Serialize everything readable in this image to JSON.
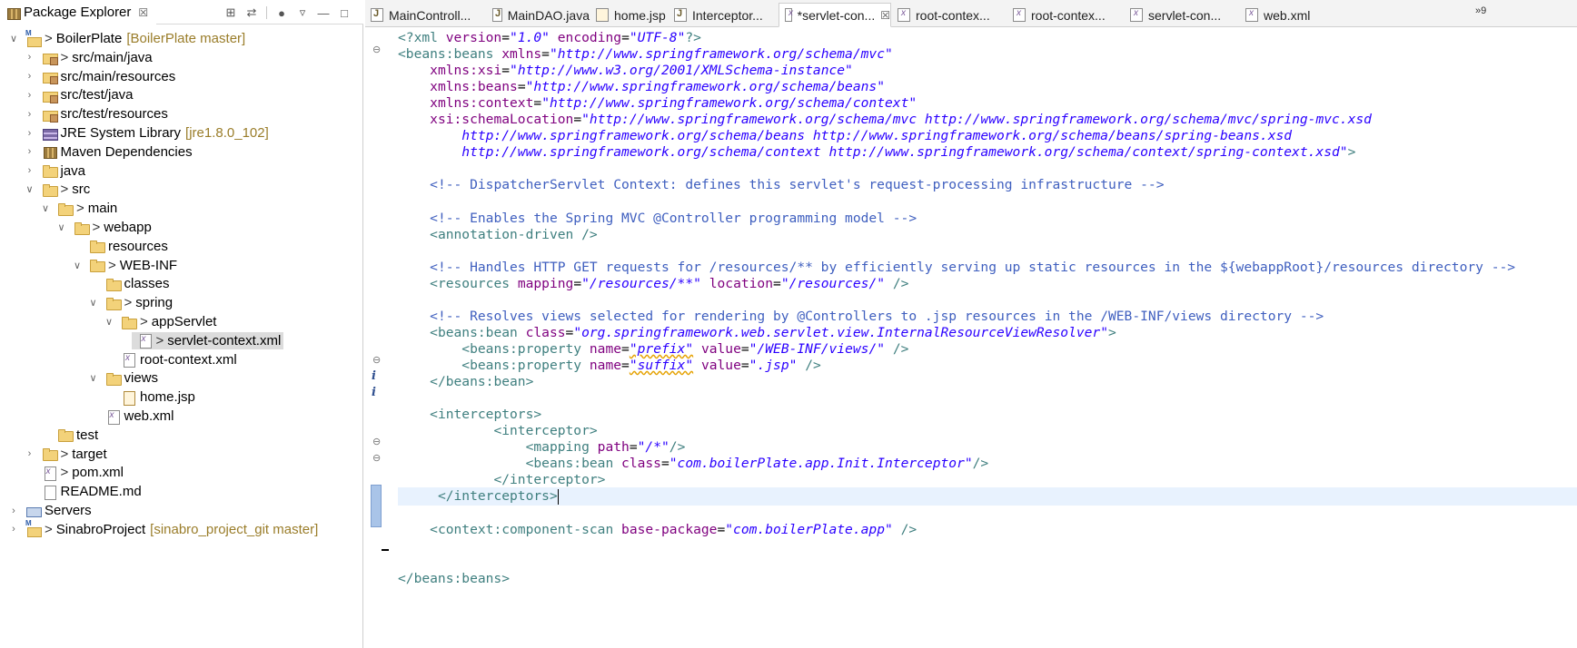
{
  "explorer": {
    "title": "Package Explorer",
    "close_glyph": "☒",
    "tree": [
      {
        "label": "BoilerPlate",
        "deco": ">",
        "git": "[BoilerPlate master]",
        "icon": "project",
        "level": 0,
        "twisty": "expanded"
      },
      {
        "label": "src/main/java",
        "deco": ">",
        "git": "",
        "icon": "pkgfolder",
        "level": 1,
        "twisty": "collapsed"
      },
      {
        "label": "src/main/resources",
        "deco": "",
        "git": "",
        "icon": "pkgfolder",
        "level": 1,
        "twisty": "collapsed"
      },
      {
        "label": "src/test/java",
        "deco": "",
        "git": "",
        "icon": "pkgfolder",
        "level": 1,
        "twisty": "collapsed"
      },
      {
        "label": "src/test/resources",
        "deco": "",
        "git": "",
        "icon": "pkgfolder",
        "level": 1,
        "twisty": "collapsed"
      },
      {
        "label": "JRE System Library",
        "deco": "",
        "git": "[jre1.8.0_102]",
        "icon": "jre",
        "level": 1,
        "twisty": "collapsed"
      },
      {
        "label": "Maven Dependencies",
        "deco": "",
        "git": "",
        "icon": "jar",
        "level": 1,
        "twisty": "collapsed"
      },
      {
        "label": "java",
        "deco": "",
        "git": "",
        "icon": "folder",
        "level": 1,
        "twisty": "collapsed"
      },
      {
        "label": "src",
        "deco": ">",
        "git": "",
        "icon": "folder",
        "level": 1,
        "twisty": "expanded"
      },
      {
        "label": "main",
        "deco": ">",
        "git": "",
        "icon": "folder",
        "level": 2,
        "twisty": "expanded"
      },
      {
        "label": "webapp",
        "deco": ">",
        "git": "",
        "icon": "folder",
        "level": 3,
        "twisty": "expanded"
      },
      {
        "label": "resources",
        "deco": "",
        "git": "",
        "icon": "folder",
        "level": 4,
        "twisty": "none"
      },
      {
        "label": "WEB-INF",
        "deco": ">",
        "git": "",
        "icon": "folder",
        "level": 4,
        "twisty": "expanded"
      },
      {
        "label": "classes",
        "deco": "",
        "git": "",
        "icon": "folder",
        "level": 5,
        "twisty": "none"
      },
      {
        "label": "spring",
        "deco": ">",
        "git": "",
        "icon": "folder",
        "level": 5,
        "twisty": "expanded"
      },
      {
        "label": "appServlet",
        "deco": ">",
        "git": "",
        "icon": "folder",
        "level": 6,
        "twisty": "expanded"
      },
      {
        "label": "servlet-context.xml",
        "deco": ">",
        "git": "",
        "icon": "xml",
        "level": 7,
        "twisty": "none",
        "selected": true
      },
      {
        "label": "root-context.xml",
        "deco": "",
        "git": "",
        "icon": "xml",
        "level": 6,
        "twisty": "none"
      },
      {
        "label": "views",
        "deco": "",
        "git": "",
        "icon": "folder",
        "level": 5,
        "twisty": "expanded"
      },
      {
        "label": "home.jsp",
        "deco": "",
        "git": "",
        "icon": "jsp",
        "level": 6,
        "twisty": "none"
      },
      {
        "label": "web.xml",
        "deco": "",
        "git": "",
        "icon": "xml",
        "level": 5,
        "twisty": "none"
      },
      {
        "label": "test",
        "deco": "",
        "git": "",
        "icon": "folder",
        "level": 2,
        "twisty": "none"
      },
      {
        "label": "target",
        "deco": ">",
        "git": "",
        "icon": "folder",
        "level": 1,
        "twisty": "collapsed"
      },
      {
        "label": "pom.xml",
        "deco": ">",
        "git": "",
        "icon": "xml",
        "level": 1,
        "twisty": "none"
      },
      {
        "label": "README.md",
        "deco": "",
        "git": "",
        "icon": "file",
        "level": 1,
        "twisty": "none"
      },
      {
        "label": "Servers",
        "deco": "",
        "git": "",
        "icon": "servers",
        "level": 0,
        "twisty": "collapsed"
      },
      {
        "label": "SinabroProject",
        "deco": ">",
        "git": "[sinabro_project_git master]",
        "icon": "project",
        "level": 0,
        "twisty": "collapsed"
      }
    ]
  },
  "editor": {
    "tabs": [
      {
        "label": "MainControll...",
        "icon": "java",
        "active": false
      },
      {
        "label": "MainDAO.java",
        "icon": "java",
        "active": false
      },
      {
        "label": "home.jsp",
        "icon": "jsp",
        "active": false
      },
      {
        "label": "Interceptor...",
        "icon": "java",
        "active": false
      },
      {
        "label": "*servlet-con...",
        "icon": "xml",
        "active": true
      },
      {
        "label": "root-contex...",
        "icon": "xml",
        "active": false
      },
      {
        "label": "root-contex...",
        "icon": "xml",
        "active": false
      },
      {
        "label": "servlet-con...",
        "icon": "xml",
        "active": false
      },
      {
        "label": "web.xml",
        "icon": "xml",
        "active": false
      }
    ],
    "overflow_count": "»9",
    "lines": [
      [
        [
          "pi",
          "<?xml "
        ],
        [
          "at",
          "version"
        ],
        [
          "",
          "="
        ],
        [
          "av",
          "\"1.0\""
        ],
        [
          "",
          " "
        ],
        [
          "at",
          "encoding"
        ],
        [
          "",
          "="
        ],
        [
          "av",
          "\"UTF-8\""
        ],
        [
          "pi",
          "?>"
        ]
      ],
      [
        [
          "tg",
          "<beans:beans "
        ],
        [
          "at",
          "xmlns"
        ],
        [
          "",
          "="
        ],
        [
          "av",
          "\"http://www.springframework.org/schema/mvc\""
        ]
      ],
      [
        [
          "",
          "    "
        ],
        [
          "at",
          "xmlns:xsi"
        ],
        [
          "",
          "="
        ],
        [
          "av",
          "\"http://www.w3.org/2001/XMLSchema-instance\""
        ]
      ],
      [
        [
          "",
          "    "
        ],
        [
          "at",
          "xmlns:beans"
        ],
        [
          "",
          "="
        ],
        [
          "av",
          "\"http://www.springframework.org/schema/beans\""
        ]
      ],
      [
        [
          "",
          "    "
        ],
        [
          "at",
          "xmlns:context"
        ],
        [
          "",
          "="
        ],
        [
          "av",
          "\"http://www.springframework.org/schema/context\""
        ]
      ],
      [
        [
          "",
          "    "
        ],
        [
          "at",
          "xsi:schemaLocation"
        ],
        [
          "",
          "="
        ],
        [
          "av",
          "\"http://www.springframework.org/schema/mvc http://www.springframework.org/schema/mvc/spring-mvc.xsd"
        ]
      ],
      [
        [
          "av",
          "        http://www.springframework.org/schema/beans http://www.springframework.org/schema/beans/spring-beans.xsd"
        ]
      ],
      [
        [
          "av",
          "        http://www.springframework.org/schema/context http://www.springframework.org/schema/context/spring-context.xsd\""
        ],
        [
          "tg",
          ">"
        ]
      ],
      [],
      [
        [
          "",
          "    "
        ],
        [
          "cm",
          "<!-- DispatcherServlet Context: defines this servlet's request-processing infrastructure -->"
        ]
      ],
      [],
      [
        [
          "",
          "    "
        ],
        [
          "cm",
          "<!-- Enables the Spring MVC @Controller programming model -->"
        ]
      ],
      [
        [
          "",
          "    "
        ],
        [
          "tg",
          "<annotation-driven />"
        ]
      ],
      [],
      [
        [
          "",
          "    "
        ],
        [
          "cm",
          "<!-- Handles HTTP GET requests for /resources/** by efficiently serving up static resources in the ${webappRoot}/resources directory -->"
        ]
      ],
      [
        [
          "",
          "    "
        ],
        [
          "tg",
          "<resources "
        ],
        [
          "at",
          "mapping"
        ],
        [
          "",
          "="
        ],
        [
          "av",
          "\"/resources/**\""
        ],
        [
          "",
          " "
        ],
        [
          "at",
          "location"
        ],
        [
          "",
          "="
        ],
        [
          "av",
          "\"/resources/\""
        ],
        [
          "",
          " "
        ],
        [
          "tg",
          "/>"
        ]
      ],
      [],
      [
        [
          "",
          "    "
        ],
        [
          "cm",
          "<!-- Resolves views selected for rendering by @Controllers to .jsp resources in the /WEB-INF/views directory -->"
        ]
      ],
      [
        [
          "",
          "    "
        ],
        [
          "tg",
          "<beans:bean "
        ],
        [
          "at",
          "class"
        ],
        [
          "",
          "="
        ],
        [
          "av",
          "\"org.springframework.web.servlet.view.InternalResourceViewResolver\""
        ],
        [
          "tg",
          ">"
        ]
      ],
      [
        [
          "",
          "        "
        ],
        [
          "tg",
          "<beans:property "
        ],
        [
          "at",
          "name"
        ],
        [
          "",
          "="
        ],
        [
          "av sq",
          "\"prefix\""
        ],
        [
          "",
          " "
        ],
        [
          "at",
          "value"
        ],
        [
          "",
          "="
        ],
        [
          "av",
          "\"/WEB-INF/views/\""
        ],
        [
          "",
          " "
        ],
        [
          "tg",
          "/>"
        ]
      ],
      [
        [
          "",
          "        "
        ],
        [
          "tg",
          "<beans:property "
        ],
        [
          "at",
          "name"
        ],
        [
          "",
          "="
        ],
        [
          "av sq",
          "\"suffix\""
        ],
        [
          "",
          " "
        ],
        [
          "at",
          "value"
        ],
        [
          "",
          "="
        ],
        [
          "av",
          "\".jsp\""
        ],
        [
          "",
          " "
        ],
        [
          "tg",
          "/>"
        ]
      ],
      [
        [
          "",
          "    "
        ],
        [
          "tg",
          "</beans:bean>"
        ]
      ],
      [],
      [
        [
          "",
          "    "
        ],
        [
          "tg",
          "<interceptors>"
        ]
      ],
      [
        [
          "",
          "            "
        ],
        [
          "tg",
          "<interceptor>"
        ]
      ],
      [
        [
          "",
          "                "
        ],
        [
          "tg",
          "<mapping "
        ],
        [
          "at",
          "path"
        ],
        [
          "",
          "="
        ],
        [
          "av",
          "\"/*\""
        ],
        [
          "tg",
          "/>"
        ]
      ],
      [
        [
          "",
          "                "
        ],
        [
          "tg",
          "<beans:bean "
        ],
        [
          "at",
          "class"
        ],
        [
          "",
          "="
        ],
        [
          "av",
          "\"com.boilerPlate.app.Init.Interceptor\""
        ],
        [
          "tg",
          "/>"
        ]
      ],
      [
        [
          "",
          "            "
        ],
        [
          "tg",
          "</interceptor>"
        ]
      ],
      [
        [
          "",
          "     "
        ],
        [
          "tg",
          "</interceptors>"
        ]
      ],
      [],
      [
        [
          "",
          "    "
        ],
        [
          "tg",
          "<context:component-scan "
        ],
        [
          "at",
          "base-package"
        ],
        [
          "",
          "="
        ],
        [
          "av",
          "\"com.boilerPlate.app\""
        ],
        [
          "",
          " "
        ],
        [
          "tg",
          "/>"
        ]
      ],
      [],
      [],
      [
        [
          "tg",
          "</beans:beans>"
        ]
      ]
    ],
    "current_line": 28
  }
}
